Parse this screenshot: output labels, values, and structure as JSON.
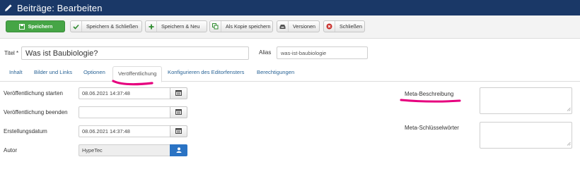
{
  "header": {
    "title": "Beiträge: Bearbeiten",
    "icon": "pencil-icon"
  },
  "toolbar": {
    "save_label": "Speichern",
    "save_close_label": "Speichern & Schließen",
    "save_new_label": "Speichern & Neu",
    "save_copy_label": "Als Kopie speichern",
    "versions_label": "Versionen",
    "close_label": "Schließen"
  },
  "form": {
    "title_label": "Titel *",
    "title_value": "Was ist Baubiologie?",
    "alias_label": "Alias",
    "alias_value": "was-ist-baubiologie"
  },
  "tabs": [
    {
      "label": "Inhalt"
    },
    {
      "label": "Bilder und Links"
    },
    {
      "label": "Optionen"
    },
    {
      "label": "Veröffentlichung"
    },
    {
      "label": "Konfigurieren des Editorfensters"
    },
    {
      "label": "Berechtigungen"
    }
  ],
  "publishing": {
    "start_label": "Veröffentlichung starten",
    "start_value": "08.06.2021 14:37:48",
    "end_label": "Veröffentlichung beenden",
    "end_value": "",
    "created_label": "Erstellungsdatum",
    "created_value": "08.06.2021 14:37:48",
    "author_label": "Autor",
    "author_value": "HypeTec"
  },
  "metadata": {
    "description_label": "Meta-Beschreibung",
    "keywords_label": "Meta-Schlüsselwörter"
  },
  "colors": {
    "header_bg": "#1a3867",
    "primary_button": "#46a546",
    "highlight": "#e6007e",
    "link": "#2a6496"
  }
}
